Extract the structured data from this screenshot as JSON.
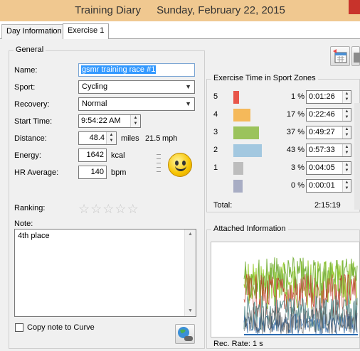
{
  "window": {
    "app_title": "Training Diary",
    "date": "Sunday, February 22, 2015"
  },
  "tabs": [
    {
      "label": "Day Information",
      "active": false
    },
    {
      "label": "Exercise 1",
      "active": true
    }
  ],
  "general": {
    "title": "General",
    "name_label": "Name:",
    "name_value": "gsmr training race #1",
    "sport_label": "Sport:",
    "sport_value": "Cycling",
    "recovery_label": "Recovery:",
    "recovery_value": "Normal",
    "start_time_label": "Start Time:",
    "start_time_value": "9:54:22 AM",
    "distance_label": "Distance:",
    "distance_value": "48.4",
    "distance_unit": "miles",
    "speed_value": "21.5",
    "speed_unit": "mph",
    "energy_label": "Energy:",
    "energy_value": "1642",
    "energy_unit": "kcal",
    "hr_label": "HR Average:",
    "hr_value": "140",
    "hr_unit": "bpm",
    "ranking_label": "Ranking:",
    "ranking_stars": 0,
    "ranking_max": 5,
    "note_label": "Note:",
    "note_value": "4th place",
    "copy_note_label": "Copy note to Curve",
    "copy_note_checked": false
  },
  "zones": {
    "title": "Exercise Time in Sport Zones",
    "rows": [
      {
        "zone": "5",
        "pct": "1 %",
        "fraction": 0.12,
        "time": "0:01:26",
        "color": "#e8564a"
      },
      {
        "zone": "4",
        "pct": "17 %",
        "fraction": 0.38,
        "time": "0:22:46",
        "color": "#f5b95a"
      },
      {
        "zone": "3",
        "pct": "37 %",
        "fraction": 0.57,
        "time": "0:49:27",
        "color": "#9bc35c"
      },
      {
        "zone": "2",
        "pct": "43 %",
        "fraction": 0.62,
        "time": "0:57:33",
        "color": "#a3c8e0"
      },
      {
        "zone": "1",
        "pct": "3 %",
        "fraction": 0.22,
        "time": "0:04:05",
        "color": "#bdbdbd"
      },
      {
        "zone": "",
        "pct": "0 %",
        "fraction": 0.2,
        "time": "0:00:01",
        "color": "#a8adc4"
      }
    ],
    "total_label": "Total:",
    "total_value": "2:15:19"
  },
  "attached": {
    "title": "Attached Information",
    "rec_rate_label": "Rec. Rate: 1 s"
  },
  "icons": {
    "calendar_button": "calendar-icon",
    "delete_button": "trash-icon",
    "globe_button": "globe-icon",
    "mood": "smiley-icon"
  }
}
